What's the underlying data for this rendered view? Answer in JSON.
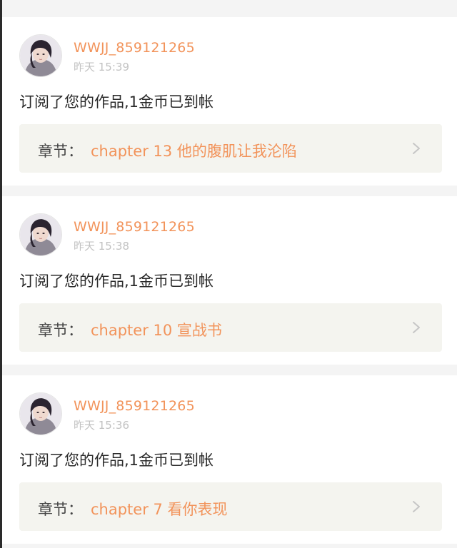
{
  "notifications": [
    {
      "username": "WWJJ_859121265",
      "time": "昨天 15:39",
      "message": "订阅了您的作品,1金币已到帐",
      "chapter_label": "章节：",
      "chapter_title": "chapter 13 他的腹肌让我沦陷",
      "avatar_icon": "user-avatar-photo",
      "chevron_icon": "chevron-right-icon"
    },
    {
      "username": "WWJJ_859121265",
      "time": "昨天 15:38",
      "message": "订阅了您的作品,1金币已到帐",
      "chapter_label": "章节：",
      "chapter_title": "chapter 10 宣战书",
      "avatar_icon": "user-avatar-photo",
      "chevron_icon": "chevron-right-icon"
    },
    {
      "username": "WWJJ_859121265",
      "time": "昨天 15:36",
      "message": "订阅了您的作品,1金币已到帐",
      "chapter_label": "章节：",
      "chapter_title": "chapter 7 看你表现",
      "avatar_icon": "user-avatar-photo",
      "chevron_icon": "chevron-right-icon"
    }
  ],
  "colors": {
    "accent": "#f2935a",
    "text": "#2a2a2a",
    "muted": "#c2c2c2",
    "chapter_bg": "#f4f4ef",
    "page_bg": "#f4f4f4"
  }
}
